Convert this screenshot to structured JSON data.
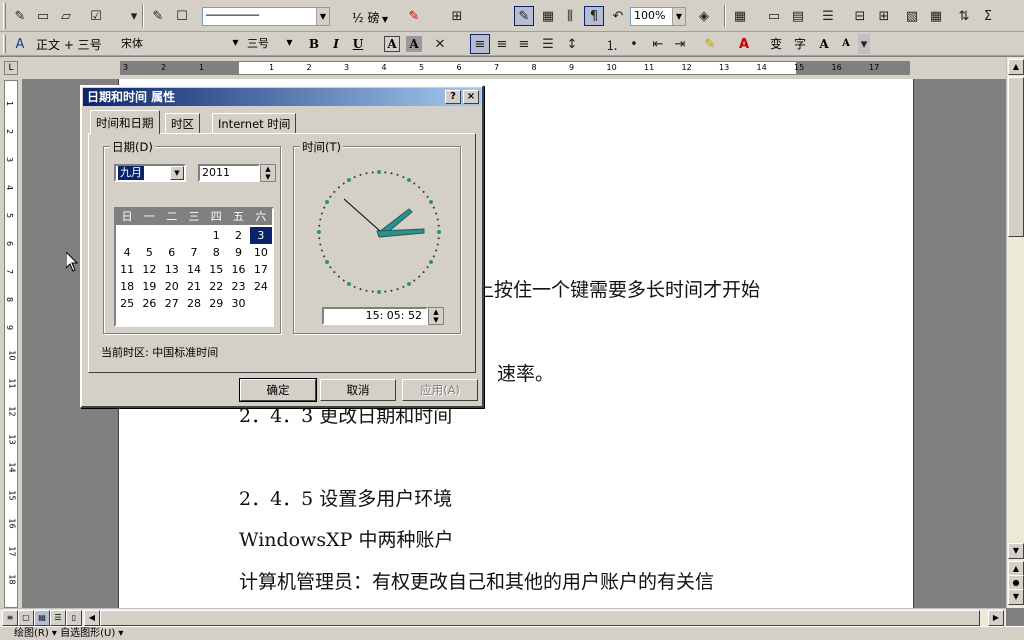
{
  "toolbar1": {
    "line_style": "────────",
    "line_weight": "½ 磅",
    "zoom": "100%"
  },
  "toolbar2": {
    "style": "正文 + 三号",
    "font": "宋体",
    "size": "三号",
    "bold": "B",
    "italic": "I",
    "underline": "U",
    "char_border": "A",
    "char_shading": "A",
    "grow_font": "A",
    "shrink_font": "A",
    "phonetic": "变",
    "enclose": "字"
  },
  "ruler": {
    "corner": "L",
    "ticks": [
      "3",
      "2",
      "1",
      "1",
      "2",
      "3",
      "4",
      "5",
      "6",
      "7",
      "8",
      "9",
      "10",
      "11",
      "12",
      "13",
      "14",
      "15",
      "16",
      "17"
    ],
    "vticks": [
      "1",
      "2",
      "3",
      "4",
      "5",
      "6",
      "7",
      "8",
      "9",
      "10",
      "11",
      "12",
      "13",
      "14",
      "15",
      "16",
      "17",
      "18"
    ]
  },
  "document": {
    "lines": [
      "上按住一个键需要多长时间才开始",
      "速率。",
      "2．4．3 更改日期和时间",
      "2．4．5 设置多用户环境",
      "WindowsXP 中两种账户",
      "计算机管理员：有权更改自己和其他的用户账户的有关信"
    ]
  },
  "drawing_bar": {
    "label": "绘图(R) ▾   自选图形(U) ▾"
  },
  "dialog": {
    "title": "日期和时间 属性",
    "help_btn": "?",
    "close_btn": "×",
    "tabs": [
      "时间和日期",
      "时区",
      "Internet 时间"
    ],
    "date_group": "日期(D)",
    "time_group": "时间(T)",
    "month": "九月",
    "year": "2011",
    "weekdays": [
      "日",
      "一",
      "二",
      "三",
      "四",
      "五",
      "六"
    ],
    "weeks": [
      [
        "",
        "",
        "",
        "",
        "1",
        "2",
        "3"
      ],
      [
        "4",
        "5",
        "6",
        "7",
        "8",
        "9",
        "10"
      ],
      [
        "11",
        "12",
        "13",
        "14",
        "15",
        "16",
        "17"
      ],
      [
        "18",
        "19",
        "20",
        "21",
        "22",
        "23",
        "24"
      ],
      [
        "25",
        "26",
        "27",
        "28",
        "29",
        "30",
        ""
      ]
    ],
    "selected_day": "3",
    "time": "15: 05: 52",
    "timezone_label": "当前时区: 中国标准时间",
    "ok": "确定",
    "cancel": "取消",
    "apply": "应用(A)"
  },
  "colors": {
    "selection": "#0a246a",
    "chrome": "#d4d0c8",
    "clock_hands": "#2f8f8a"
  }
}
